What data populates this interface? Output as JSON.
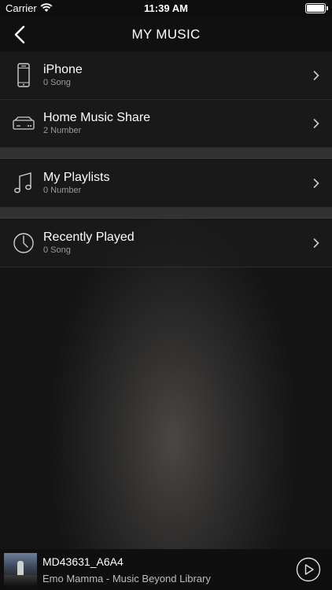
{
  "status_bar": {
    "carrier": "Carrier",
    "time": "11:39 AM"
  },
  "header": {
    "title": "MY MUSIC"
  },
  "rows": [
    {
      "icon": "phone-icon",
      "title": "iPhone",
      "subtitle": "0 Song"
    },
    {
      "icon": "network-drive-icon",
      "title": "Home Music Share",
      "subtitle": "2 Number"
    },
    {
      "icon": "music-note-icon",
      "title": "My Playlists",
      "subtitle": "0 Number"
    },
    {
      "icon": "clock-icon",
      "title": "Recently Played",
      "subtitle": "0 Song"
    }
  ],
  "now_playing": {
    "title": "MD43631_A6A4",
    "subtitle": "Emo Mamma - Music Beyond Library"
  }
}
